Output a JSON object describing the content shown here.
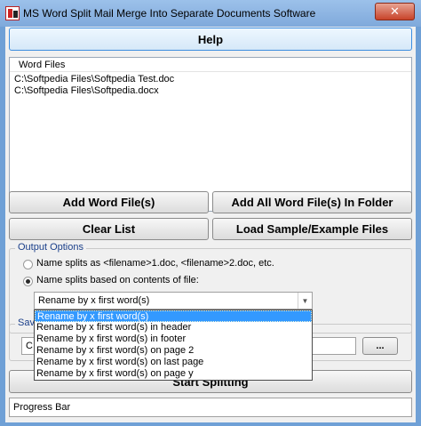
{
  "window": {
    "title": "MS Word Split Mail Merge Into Separate Documents Software",
    "close_glyph": "✕"
  },
  "help_button": "Help",
  "files": {
    "header": "Word Files",
    "items": [
      "C:\\Softpedia Files\\Softpedia Test.doc",
      "C:\\Softpedia Files\\Softpedia.docx"
    ]
  },
  "buttons": {
    "add_files": "Add Word File(s)",
    "add_folder": "Add All Word File(s) In Folder",
    "clear_list": "Clear List",
    "load_sample": "Load Sample/Example Files",
    "start": "Start Splitting",
    "browse": "..."
  },
  "output_options": {
    "title": "Output Options",
    "radio_1": "Name splits as <filename>1.doc, <filename>2.doc, etc.",
    "radio_2": "Name splits based on contents of file:",
    "selected_radio": 2,
    "select_value": "Rename by x first word(s)",
    "options": [
      "Rename by x first word(s)",
      "Rename by x first word(s) in header",
      "Rename by x first word(s) in footer",
      "Rename by x first word(s) on page 2",
      "Rename by x first word(s) on last page",
      "Rename by x first word(s) on page y"
    ]
  },
  "save": {
    "title": "Sav",
    "path_visible": "C:"
  },
  "progress": {
    "label": "Progress Bar"
  },
  "colors": {
    "titlebar": "#7fa9db",
    "selection": "#3399ff",
    "group_title": "#1a3f8a"
  }
}
